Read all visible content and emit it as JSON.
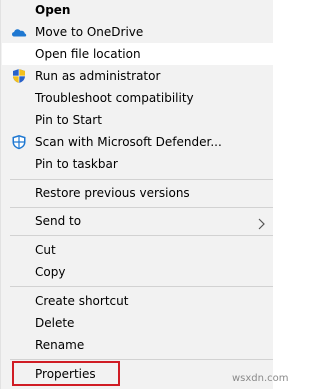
{
  "context_menu": {
    "items": [
      {
        "label": "Open",
        "bold": true
      },
      {
        "label": "Move to OneDrive",
        "icon": "onedrive-cloud-icon"
      },
      {
        "label": "Open file location"
      },
      {
        "label": "Run as administrator",
        "icon": "uac-shield-icon"
      },
      {
        "label": "Troubleshoot compatibility"
      },
      {
        "label": "Pin to Start"
      },
      {
        "label": "Scan with Microsoft Defender...",
        "icon": "defender-icon"
      },
      {
        "label": "Pin to taskbar"
      },
      {
        "label": "Restore previous versions"
      },
      {
        "label": "Send to",
        "submenu": true
      },
      {
        "label": "Cut"
      },
      {
        "label": "Copy"
      },
      {
        "label": "Create shortcut"
      },
      {
        "label": "Delete"
      },
      {
        "label": "Rename"
      },
      {
        "label": "Properties",
        "highlighted": true
      }
    ],
    "colors": {
      "menu_background": "#f2f2f2",
      "hover_background": "#ffffff",
      "separator": "#d2d2d2",
      "highlight_border": "#d01c24",
      "onedrive_blue": "#1f78d1",
      "defender_blue": "#1f78d1"
    }
  },
  "watermark": "wsxdn.com"
}
